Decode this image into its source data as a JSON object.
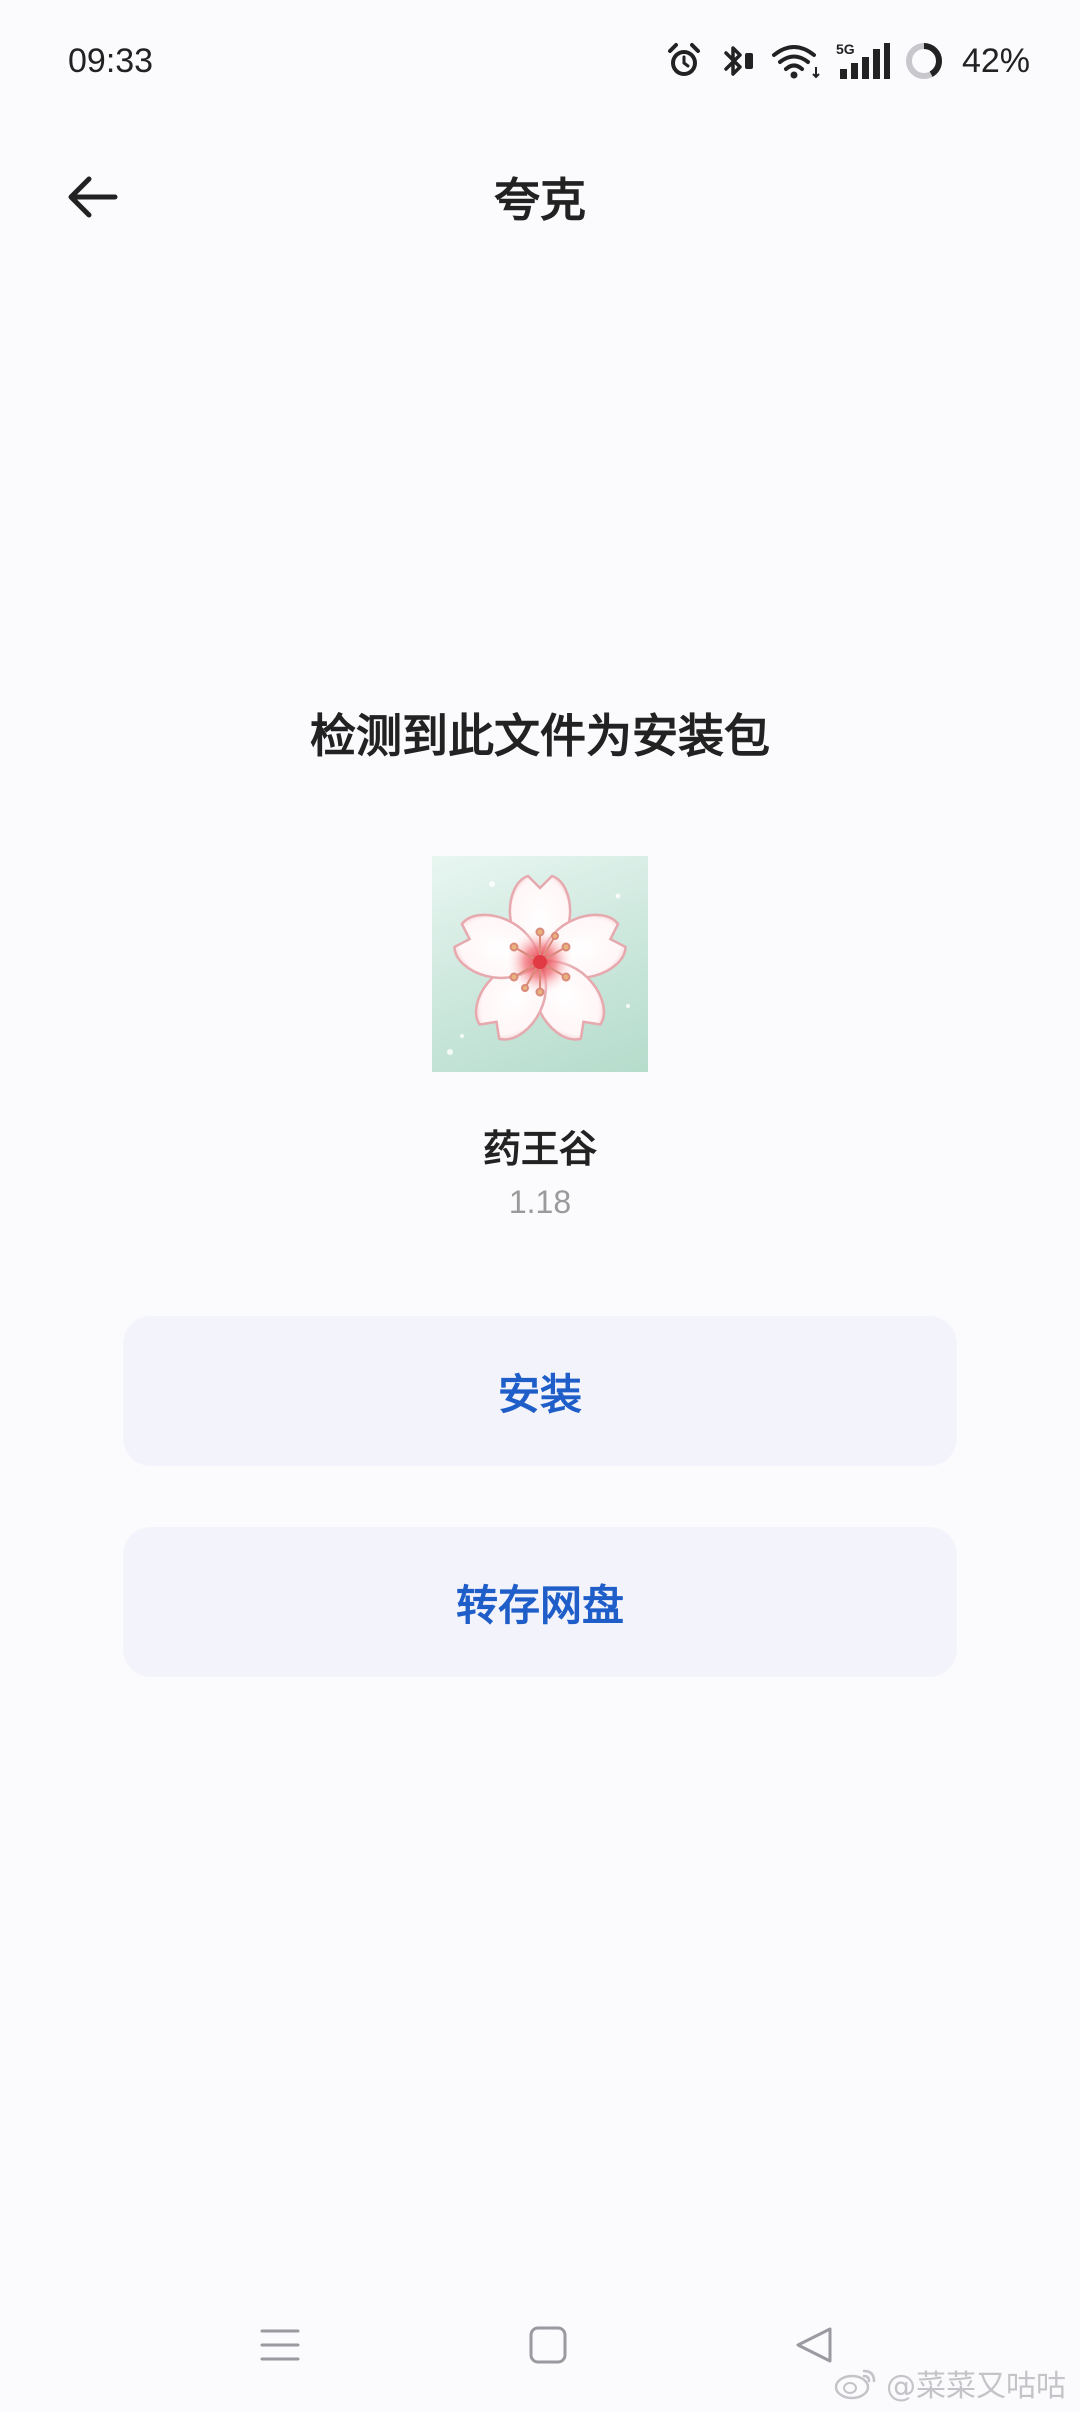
{
  "status_bar": {
    "time": "09:33",
    "network": "5G",
    "battery": "42%",
    "battery_level": 0.42
  },
  "header": {
    "title": "夸克",
    "back_icon": "arrow-left-icon"
  },
  "main": {
    "headline": "检测到此文件为安装包",
    "app": {
      "icon": "cherry-blossom-icon",
      "name": "药王谷",
      "version": "1.18"
    },
    "buttons": {
      "install_label": "安装",
      "save_label": "转存网盘"
    }
  },
  "nav_bar": {
    "menu_icon": "menu-icon",
    "home_icon": "home-square-icon",
    "back_icon": "back-triangle-icon"
  },
  "watermark": {
    "text": "@菜菜又咕咕"
  },
  "colors": {
    "accent": "#1f5ec9",
    "button_bg": "#f3f4fb",
    "background": "#fbfbfd",
    "text": "#222222",
    "muted": "#9a9a9a"
  }
}
